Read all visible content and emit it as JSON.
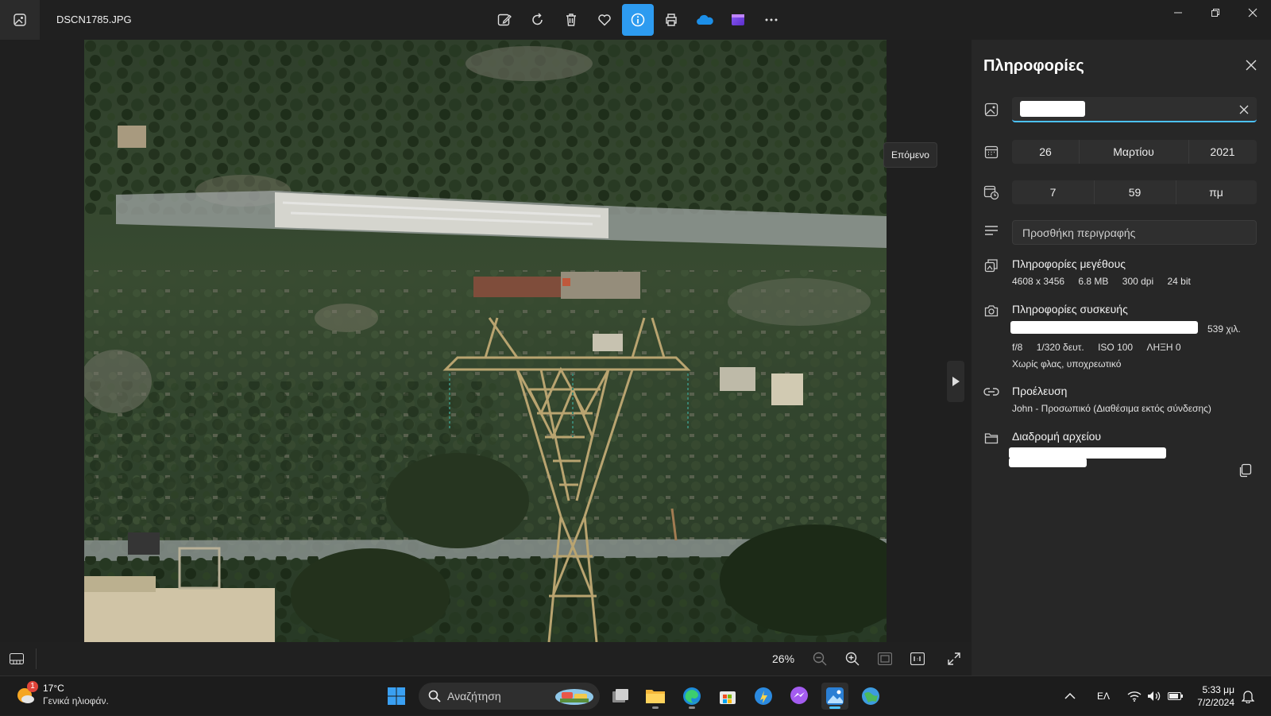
{
  "window": {
    "file_name": "DSCN1785.JPG"
  },
  "toolbar": {
    "icons": [
      "edit-image-icon",
      "rotate-icon",
      "delete-icon",
      "favorite-icon",
      "info-icon",
      "print-icon",
      "onedrive-icon",
      "clipchamp-icon",
      "more-icon"
    ],
    "active": "info-icon"
  },
  "viewer": {
    "next_tooltip": "Επόμενο",
    "zoom": "26%"
  },
  "info_panel": {
    "title": "Πληροφορίες",
    "date": {
      "day": "26",
      "month": "Μαρτίου",
      "year": "2021"
    },
    "time": {
      "hour": "7",
      "minute": "59",
      "ampm": "πμ"
    },
    "description_placeholder": "Προσθήκη περιγραφής",
    "size_info": {
      "heading": "Πληροφορίες μεγέθους",
      "dimensions": "4608 x 3456",
      "file_size": "6.8 MB",
      "dpi": "300 dpi",
      "bit_depth": "24 bit"
    },
    "device_info": {
      "heading": "Πληροφορίες συσκευής",
      "focal": "539 χιλ.",
      "aperture": "f/8",
      "exposure": "1/320 δευτ.",
      "iso": "ISO 100",
      "exposure_bias": "ΛΗΞΗ 0",
      "flash": "Χωρίς φλας, υποχρεωτικό"
    },
    "source": {
      "heading": "Προέλευση",
      "value": "John - Προσωπικό (Διαθέσιμα εκτός σύνδεσης)"
    },
    "file_path": {
      "heading": "Διαδρομή αρχείου"
    }
  },
  "taskbar": {
    "weather_temp": "17°C",
    "weather_condition": "Γενικά ηλιοφάν.",
    "weather_badge": "1",
    "search_placeholder": "Αναζήτηση",
    "language": "ΕΛ",
    "time": "5:33 μμ",
    "date": "7/2/2024"
  }
}
